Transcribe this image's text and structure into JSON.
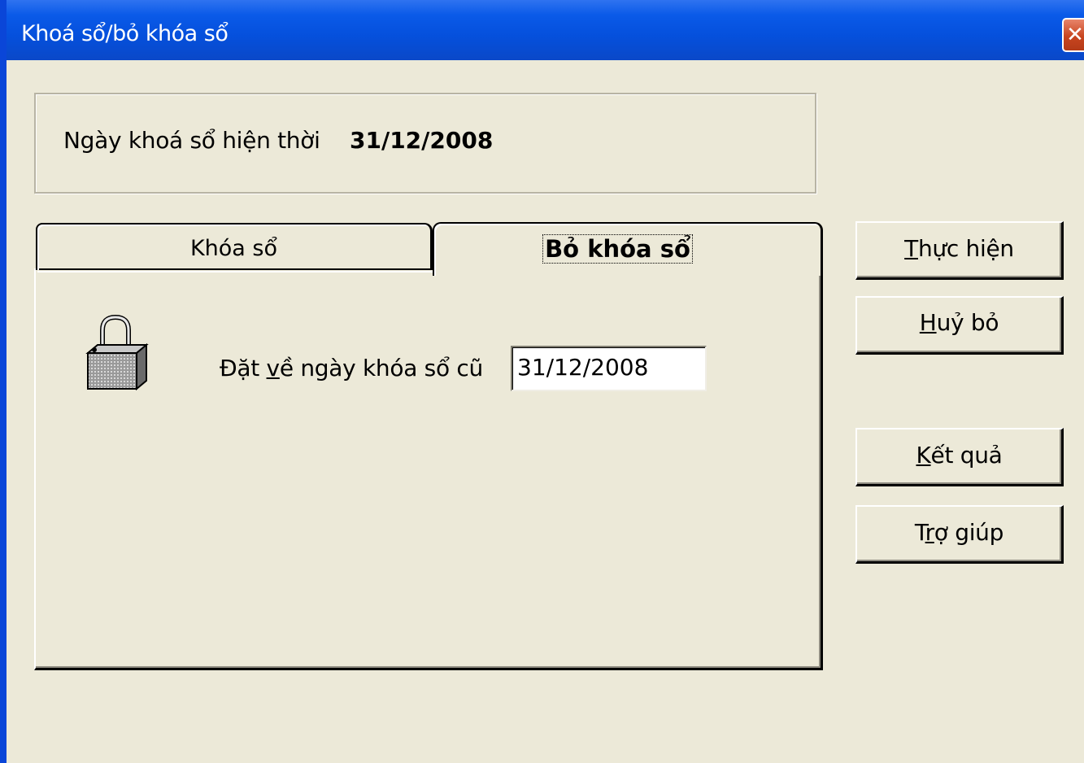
{
  "window": {
    "title": "Khoá sổ/bỏ khóa sổ",
    "close_glyph": "✕"
  },
  "current": {
    "label": "Ngày khoá sổ hiện thời",
    "value": "31/12/2008"
  },
  "tabs": [
    {
      "label": "Khóa sổ",
      "active": false
    },
    {
      "label": "Bỏ khóa sổ",
      "active": true
    }
  ],
  "panel": {
    "icon": "padlock-open-icon",
    "field_label_pre": "Đặt ",
    "field_label_mnemonic": "v",
    "field_label_post": "ề ngày khóa sổ cũ",
    "date_value": "31/12/2008"
  },
  "buttons": {
    "run": {
      "mnemonic": "T",
      "rest": "hực hiện"
    },
    "cancel": {
      "mnemonic": "H",
      "rest": "uỷ bỏ"
    },
    "result": {
      "mnemonic": "K",
      "rest": "ết quả"
    },
    "help": {
      "pre": "T",
      "mnemonic": "r",
      "rest": "ợ giúp"
    }
  },
  "colors": {
    "titlebar": "#0a5ae8",
    "dialog_bg": "#ece9d8",
    "close_button": "#c8451f"
  }
}
